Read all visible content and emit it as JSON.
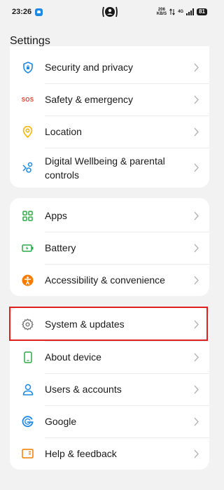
{
  "status_bar": {
    "time": "23:26",
    "network_speed_value": "206",
    "network_speed_unit": "KB/S",
    "network_type": "4G",
    "battery": "81"
  },
  "page": {
    "title": "Settings"
  },
  "groups": [
    {
      "items": [
        {
          "label": "Security and privacy",
          "icon": "shield-icon",
          "color": "#1e88e5"
        },
        {
          "label": "Safety & emergency",
          "icon": "sos-icon",
          "icon_text": "SOS",
          "color": "#e53935"
        },
        {
          "label": "Location",
          "icon": "location-pin-icon",
          "color": "#f5b800"
        },
        {
          "label_line1": "Digital Wellbeing & parental",
          "label_line2": "controls",
          "icon": "digital-wellbeing-icon",
          "color": "#1e88e5"
        }
      ]
    },
    {
      "items": [
        {
          "label": "Apps",
          "icon": "apps-icon",
          "color": "#2eaa4a"
        },
        {
          "label": "Battery",
          "icon": "battery-icon",
          "color": "#2eaa4a"
        },
        {
          "label": "Accessibility & convenience",
          "icon": "accessibility-icon",
          "color": "#f57c00"
        }
      ]
    },
    {
      "items": [
        {
          "label": "System & updates",
          "icon": "gear-icon",
          "color": "#707070",
          "highlighted": true
        },
        {
          "label": "About device",
          "icon": "phone-icon",
          "color": "#2eaa4a"
        },
        {
          "label": "Users & accounts",
          "icon": "user-icon",
          "color": "#1e88e5"
        },
        {
          "label": "Google",
          "icon": "google-icon",
          "color": "#1e88e5"
        },
        {
          "label": "Help & feedback",
          "icon": "feedback-icon",
          "color": "#f57c00"
        }
      ]
    }
  ],
  "colors": {
    "background": "#f2f2f2",
    "card": "#ffffff",
    "highlight_border": "#e0201e",
    "chevron": "#b5b5b5"
  }
}
